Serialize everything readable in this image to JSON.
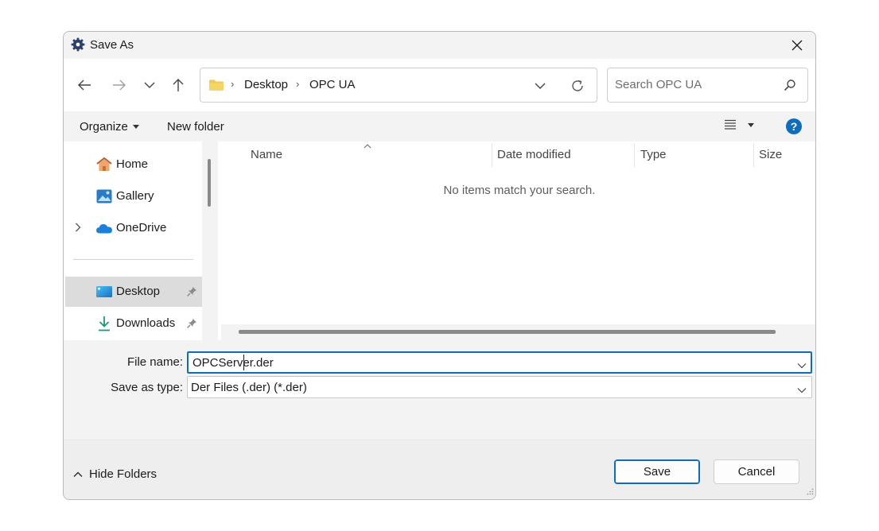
{
  "window": {
    "title": "Save As",
    "title_icon": "gear-icon",
    "close_icon": "close-icon"
  },
  "nav": {
    "back_icon": "arrow-left-icon",
    "forward_icon": "arrow-right-icon",
    "recent_icon": "chevron-down-icon",
    "up_icon": "arrow-up-icon"
  },
  "address": {
    "folder_icon": "folder-icon",
    "crumbs": [
      "Desktop",
      "OPC UA"
    ],
    "dropdown_icon": "chevron-down-icon",
    "refresh_icon": "refresh-icon"
  },
  "search": {
    "placeholder": "Search OPC UA",
    "value": "",
    "icon": "search-icon"
  },
  "toolbar": {
    "organize_label": "Organize",
    "new_folder_label": "New folder",
    "view_icon": "list-view-icon",
    "help_label": "?"
  },
  "sidebar": {
    "items": [
      {
        "label": "Home",
        "icon": "home-icon",
        "pinned": false,
        "expandable": false,
        "selected": false
      },
      {
        "label": "Gallery",
        "icon": "gallery-icon",
        "pinned": false,
        "expandable": false,
        "selected": false
      },
      {
        "label": "OneDrive",
        "icon": "cloud-icon",
        "pinned": false,
        "expandable": true,
        "selected": false
      },
      {
        "label": "Desktop",
        "icon": "desktop-icon",
        "pinned": true,
        "expandable": false,
        "selected": true
      },
      {
        "label": "Downloads",
        "icon": "download-icon",
        "pinned": true,
        "expandable": false,
        "selected": false
      }
    ]
  },
  "file_list": {
    "columns": [
      "Name",
      "Date modified",
      "Type",
      "Size"
    ],
    "sort_column": "Name",
    "empty_message": "No items match your search."
  },
  "form": {
    "file_name_label": "File name:",
    "file_name_value": "OPCServer.der",
    "save_type_label": "Save as type:",
    "save_type_value": "Der Files (.der) (*.der)"
  },
  "footer": {
    "hide_folders_label": "Hide Folders",
    "save_label": "Save",
    "cancel_label": "Cancel"
  },
  "colors": {
    "accent": "#0f6cbd",
    "folder": "#f2c94c",
    "selected_bg": "#dcdcdc"
  }
}
